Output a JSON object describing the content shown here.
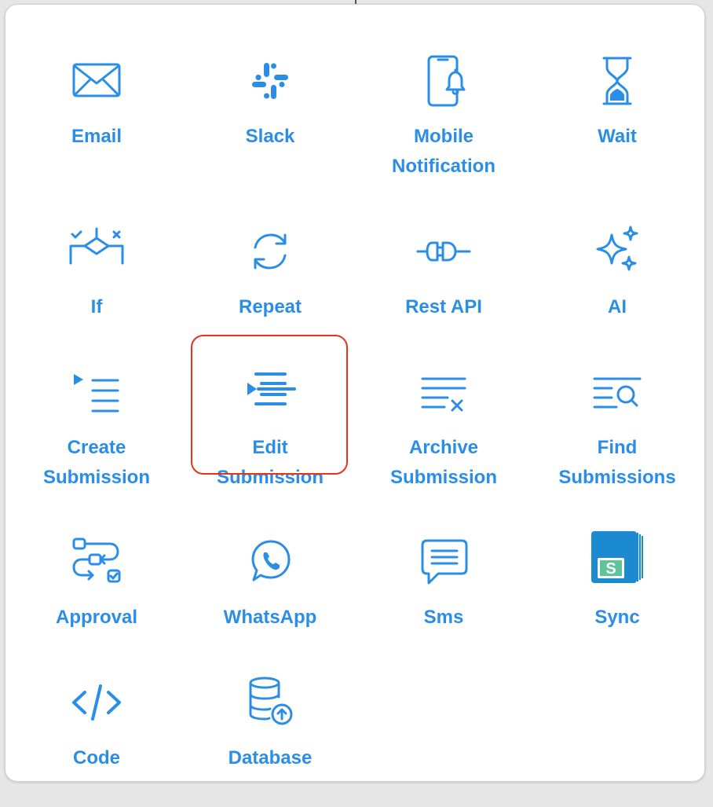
{
  "accent_color": "#2b8ee6",
  "selection_color": "#e5331c",
  "selected_tile": "edit-submission",
  "tiles": [
    {
      "label": "Email",
      "icon": "envelope-icon"
    },
    {
      "label": "Slack",
      "icon": "slack-icon"
    },
    {
      "label": "Mobile\nNotification",
      "icon": "mobile-bell-icon"
    },
    {
      "label": "Wait",
      "icon": "hourglass-icon"
    },
    {
      "label": "If",
      "icon": "branch-icon"
    },
    {
      "label": "Repeat",
      "icon": "repeat-icon"
    },
    {
      "label": "Rest API",
      "icon": "plug-icon"
    },
    {
      "label": "AI",
      "icon": "sparkles-icon"
    },
    {
      "label": "Create\nSubmission",
      "icon": "create-list-icon"
    },
    {
      "label": "Edit\nSubmission",
      "icon": "edit-list-icon"
    },
    {
      "label": "Archive\nSubmission",
      "icon": "archive-list-icon"
    },
    {
      "label": "Find\nSubmissions",
      "icon": "search-list-icon"
    },
    {
      "label": "Approval",
      "icon": "approval-flow-icon"
    },
    {
      "label": "WhatsApp",
      "icon": "whatsapp-icon"
    },
    {
      "label": "Sms",
      "icon": "chat-bubble-icon"
    },
    {
      "label": "Sync",
      "icon": "sync-app-icon"
    },
    {
      "label": "Code",
      "icon": "code-icon"
    },
    {
      "label": "Database",
      "icon": "database-upload-icon"
    }
  ]
}
